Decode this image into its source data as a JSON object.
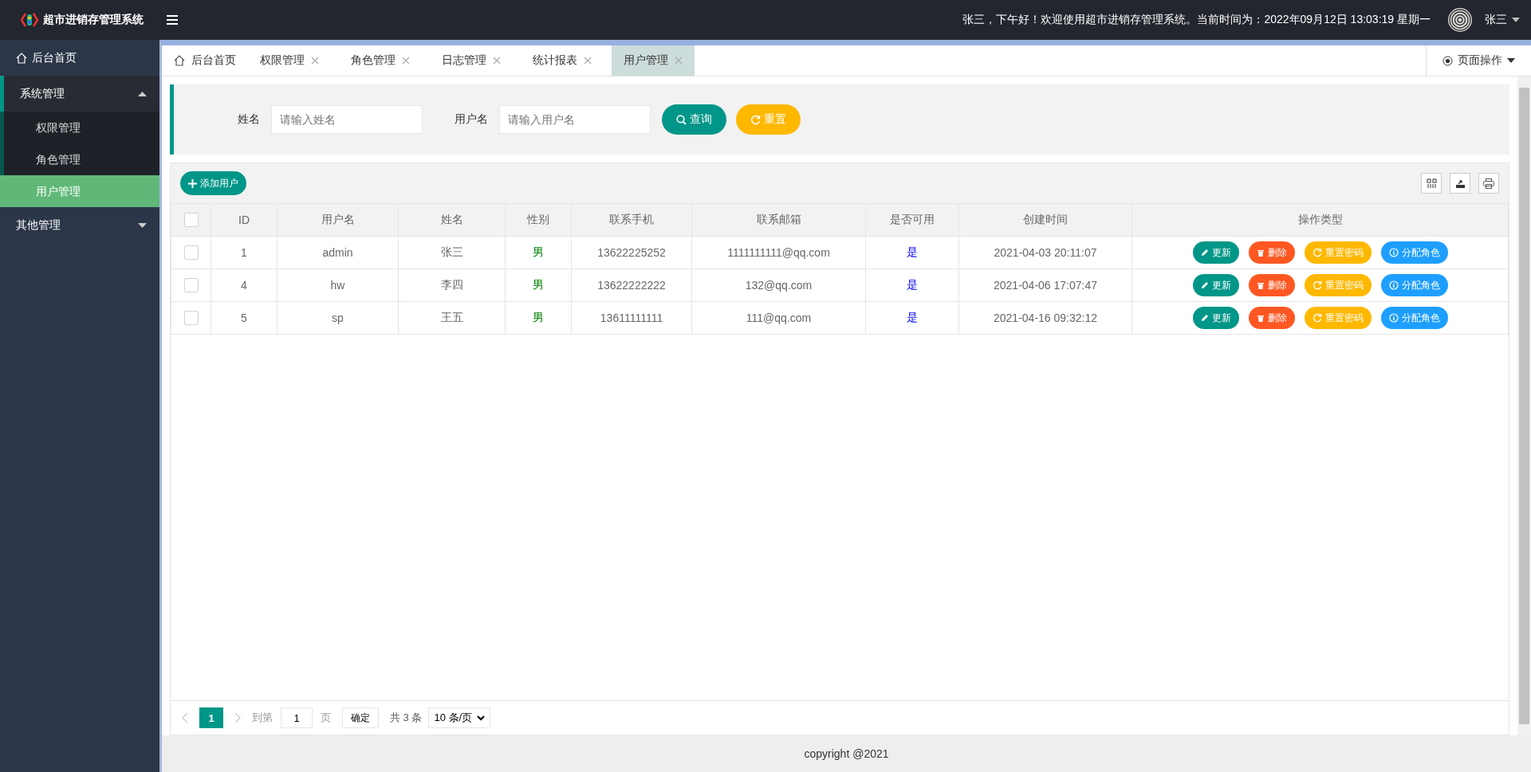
{
  "header": {
    "logo_text": "超市进销存管理系统",
    "greeting": "张三，下午好！欢迎使用超市进销存管理系统。当前时间为：2022年09月12日 13:03:19 星期一",
    "user": "张三"
  },
  "sidebar": {
    "items": [
      {
        "label": "后台首页",
        "kind": "home",
        "selected": false,
        "expanded": false
      },
      {
        "label": "系统管理",
        "kind": "group",
        "selected": false,
        "expanded": true,
        "children": [
          {
            "label": "权限管理",
            "selected": false
          },
          {
            "label": "角色管理",
            "selected": false
          },
          {
            "label": "用户管理",
            "selected": true
          }
        ]
      },
      {
        "label": "其他管理",
        "kind": "group",
        "selected": false,
        "expanded": false
      }
    ]
  },
  "tabs": [
    {
      "label": "后台首页",
      "kind": "home",
      "selected": false
    },
    {
      "label": "权限管理",
      "kind": "closable",
      "selected": false
    },
    {
      "label": "角色管理",
      "kind": "closable",
      "selected": false
    },
    {
      "label": "日志管理",
      "kind": "closable",
      "selected": false
    },
    {
      "label": "统计报表",
      "kind": "closable",
      "selected": false
    },
    {
      "label": "用户管理",
      "kind": "closable",
      "selected": true
    }
  ],
  "page_actions": "页面操作",
  "search": {
    "fields": [
      {
        "label": "姓名",
        "placeholder": "请输入姓名"
      },
      {
        "label": "用户名",
        "placeholder": "请输入用户名"
      }
    ],
    "query_button": "查询",
    "reset_button": "重置"
  },
  "toolbar": {
    "add_button": "添加用户"
  },
  "table": {
    "all_checked": false,
    "columns": [
      "ID",
      "用户名",
      "姓名",
      "性别",
      "联系手机",
      "联系邮箱",
      "是否可用",
      "创建时间",
      "操作类型"
    ],
    "rows": [
      {
        "checked": false,
        "cells": [
          "1",
          "admin",
          "张三",
          "男",
          "13622225252",
          "1111111111@qq.com",
          "是",
          "2021-04-03 20:11:07"
        ],
        "actions": [
          {
            "kind": "edit",
            "label": "更新"
          },
          {
            "kind": "delete",
            "label": "删除"
          },
          {
            "kind": "reset",
            "label": "重置密码"
          },
          {
            "kind": "assign",
            "label": "分配角色"
          }
        ]
      },
      {
        "checked": false,
        "cells": [
          "4",
          "hw",
          "李四",
          "男",
          "13622222222",
          "132@qq.com",
          "是",
          "2021-04-06 17:07:47"
        ],
        "actions": [
          {
            "kind": "edit",
            "label": "更新"
          },
          {
            "kind": "delete",
            "label": "删除"
          },
          {
            "kind": "reset",
            "label": "重置密码"
          },
          {
            "kind": "assign",
            "label": "分配角色"
          }
        ]
      },
      {
        "checked": false,
        "cells": [
          "5",
          "sp",
          "王五",
          "男",
          "13611111111",
          "111@qq.com",
          "是",
          "2021-04-16 09:32:12"
        ],
        "actions": [
          {
            "kind": "edit",
            "label": "更新"
          },
          {
            "kind": "delete",
            "label": "删除"
          },
          {
            "kind": "reset",
            "label": "重置密码"
          },
          {
            "kind": "assign",
            "label": "分配角色"
          }
        ]
      }
    ]
  },
  "pagination": {
    "pages": [
      {
        "label": "1",
        "selected": true
      }
    ],
    "goto_label": "到第",
    "goto_value": "1",
    "page_unit": "页",
    "confirm": "确定",
    "total": "共 3 条",
    "page_size": "10 条/页"
  },
  "footer": "copyright @2021"
}
